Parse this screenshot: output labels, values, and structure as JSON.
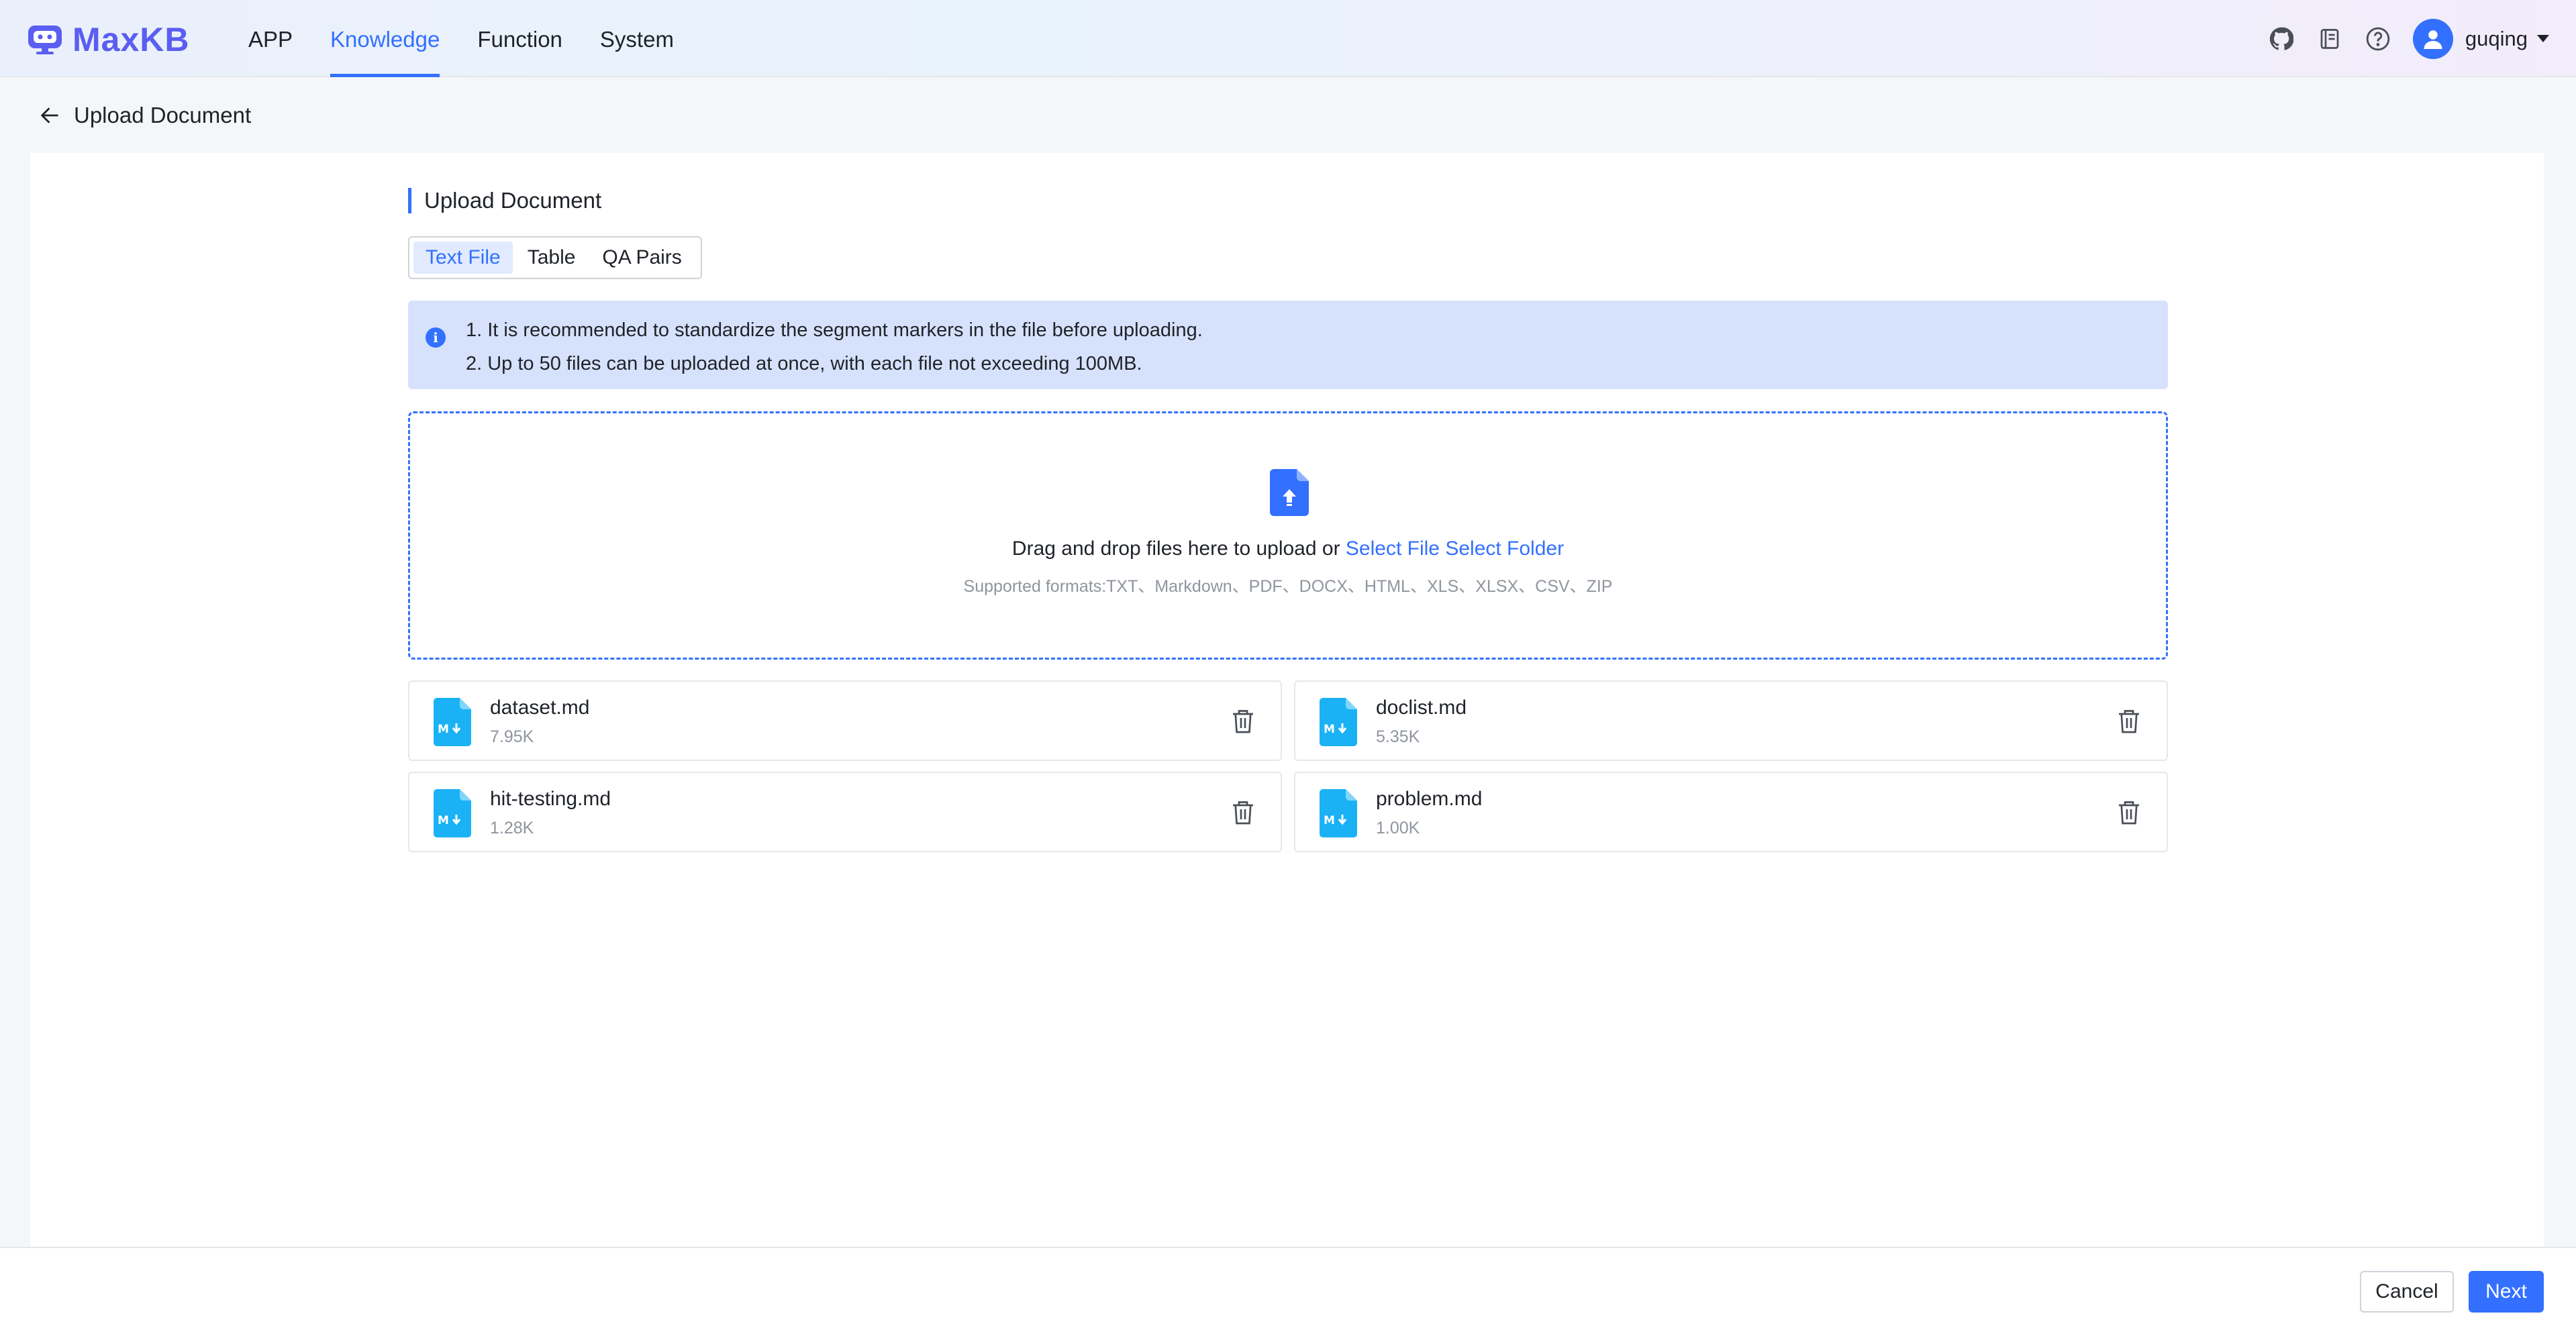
{
  "header": {
    "brand": "MaxKB",
    "nav": [
      {
        "label": "APP"
      },
      {
        "label": "Knowledge"
      },
      {
        "label": "Function"
      },
      {
        "label": "System"
      }
    ],
    "active_nav": "Knowledge",
    "icons": [
      "github-icon",
      "book-icon",
      "help-icon"
    ],
    "username": "guqing"
  },
  "subheader": {
    "title": "Upload Document"
  },
  "section_title": "Upload Document",
  "tabs": [
    {
      "label": "Text File"
    },
    {
      "label": "Table"
    },
    {
      "label": "QA Pairs"
    }
  ],
  "active_tab": "Text File",
  "alert": {
    "line1": "1. It is recommended to standardize the segment markers in the file before uploading.",
    "line2": "2. Up to 50 files can be uploaded at once, with each file not exceeding 100MB."
  },
  "dropzone": {
    "text": "Drag and drop files here to upload or",
    "select_file": "Select File",
    "select_folder": "Select Folder",
    "formats": "Supported formats:TXT、Markdown、PDF、DOCX、HTML、XLS、XLSX、CSV、ZIP"
  },
  "files": [
    {
      "name": "dataset.md",
      "size": "7.95K"
    },
    {
      "name": "doclist.md",
      "size": "5.35K"
    },
    {
      "name": "hit-testing.md",
      "size": "1.28K"
    },
    {
      "name": "problem.md",
      "size": "1.00K"
    }
  ],
  "footer": {
    "cancel": "Cancel",
    "next": "Next"
  },
  "colors": {
    "accent": "#3370ff",
    "brand": "#5b5ef0",
    "md_icon": "#1ab2f5"
  }
}
